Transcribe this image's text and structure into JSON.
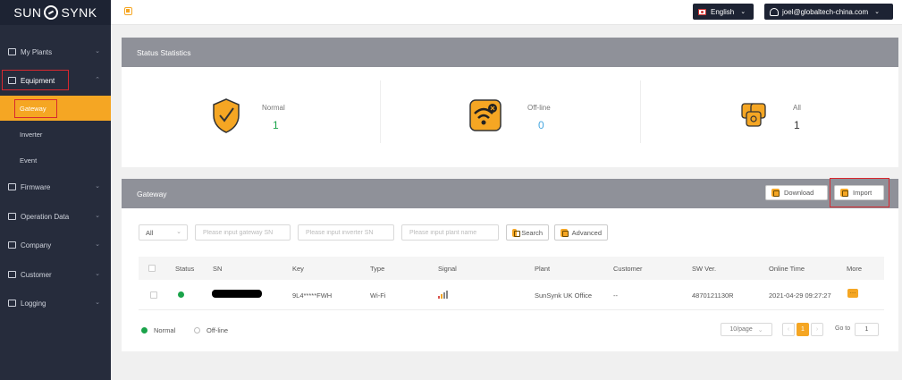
{
  "app": {
    "logo_left": "SUN",
    "logo_right": "SYNK",
    "language": "English",
    "user_email": "joel@globaltech-china.com"
  },
  "sidebar": {
    "items": [
      {
        "label": "My Plants"
      },
      {
        "label": "Equipment"
      },
      {
        "label": "Gateway"
      },
      {
        "label": "Inverter"
      },
      {
        "label": "Event"
      },
      {
        "label": "Firmware"
      },
      {
        "label": "Operation Data"
      },
      {
        "label": "Company"
      },
      {
        "label": "Customer"
      },
      {
        "label": "Logging"
      }
    ]
  },
  "status": {
    "title": "Status Statistics",
    "normal_label": "Normal",
    "normal_value": "1",
    "offline_label": "Off-line",
    "offline_value": "0",
    "all_label": "All",
    "all_value": "1"
  },
  "gateway": {
    "title": "Gateway",
    "download_label": "Download",
    "import_label": "Import",
    "filter_select": "All",
    "gateway_sn_placeholder": "Please input gateway SN",
    "inverter_sn_placeholder": "Please input inverter SN",
    "plant_name_placeholder": "Please input plant name",
    "search_label": "Search",
    "advanced_label": "Advanced",
    "columns": [
      "Status",
      "SN",
      "Key",
      "Type",
      "Signal",
      "Plant",
      "Customer",
      "SW Ver.",
      "Online Time",
      "More"
    ],
    "rows": [
      {
        "key": "9L4*****FWH",
        "type": "Wi-Fi",
        "plant": "SunSynk UK Office",
        "customer": "--",
        "sw_ver": "4870121130R",
        "online_time": "2021-04-29 09:27:27"
      }
    ],
    "legend_normal": "Normal",
    "legend_offline": "Off-line",
    "page_size": "10/page",
    "current_page": "1",
    "goto_label": "Go to",
    "goto_value": "1"
  },
  "colors": {
    "accent": "#f5a623",
    "sidebar_bg": "#262c3c",
    "status_normal": "#1aa34a",
    "status_offline": "#bbbbbb",
    "highlight_box": "#d8282f"
  }
}
